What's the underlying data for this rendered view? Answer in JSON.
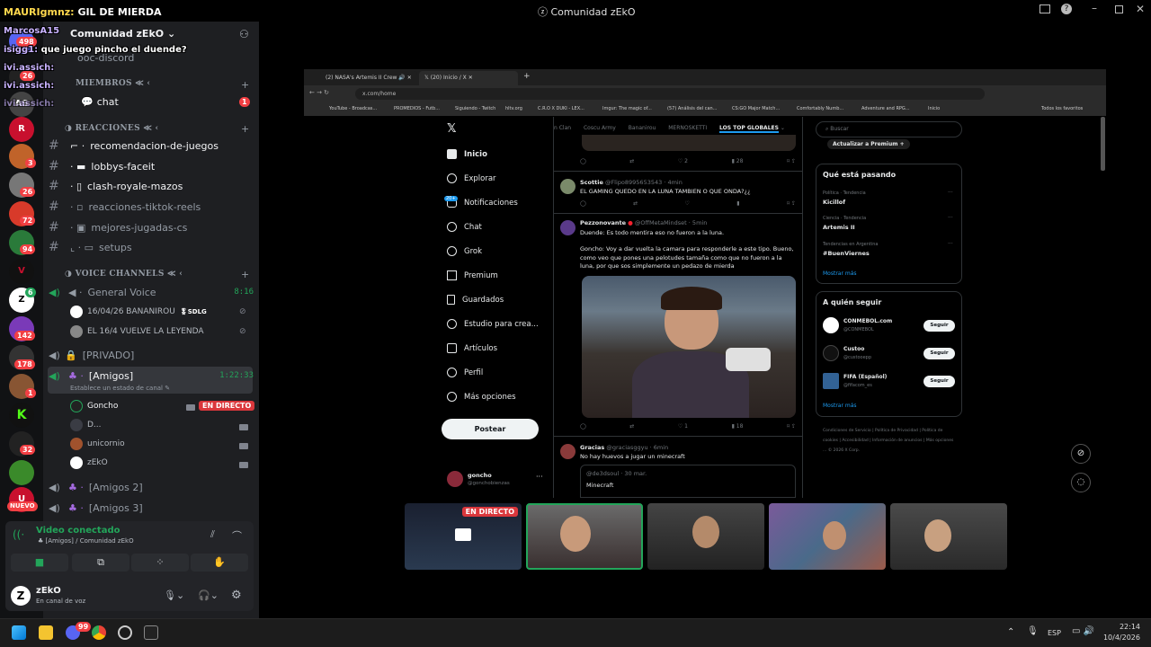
{
  "window": {
    "title": "Comunidad zEkO",
    "streaming_icon": "ⓩ"
  },
  "top_chat": {
    "user": "MAURIgmnz:",
    "msg": "GIL DE MIERDA"
  },
  "server": {
    "name": "Comunidad zEkO"
  },
  "overlay_chat": [
    {
      "user": "MarcosA15",
      "msg": ""
    },
    {
      "user": "isigg1:",
      "msg": "que juego pincho el duende?"
    },
    {
      "user": "ivi.assich:",
      "msg": ""
    },
    {
      "user": "ivi.assich:",
      "msg": ""
    },
    {
      "user": "ivi.assich:",
      "msg": ""
    }
  ],
  "guild_badges": [
    "498",
    "26",
    "3",
    "26",
    "72",
    "94",
    "6",
    "142",
    "178",
    "1",
    "32",
    "NUEVO"
  ],
  "channels": {
    "ooc": "ooc-discord",
    "cat_miembros": "MIEMBROS",
    "chat": "chat",
    "chat_badge": "1",
    "cat_reacciones": "REACCIONES",
    "list": [
      "recomendacion-de-juegos",
      "lobbys-faceit",
      "clash-royale-mazos",
      "reacciones-tiktok-reels",
      "mejores-jugadas-cs",
      "setups"
    ],
    "cat_voice": "VOICE CHANNELS",
    "general_voice": "General Voice",
    "general_time": "8:16",
    "gv_users": [
      {
        "name": "16/04/26 BANANIROU",
        "tag": "SDLG"
      },
      {
        "name": "EL 16/4 VUELVE LA LEYENDA",
        "tag": ""
      }
    ],
    "privado": "[PRIVADO]",
    "amigos": "[Amigos]",
    "amigos_time": "1:22:33",
    "amigos_status": "Establece un estado de canal",
    "amigos_users": [
      {
        "name": "Goncho",
        "live": "EN DIRECTO"
      },
      {
        "name": "D..."
      },
      {
        "name": "unicornio"
      },
      {
        "name": "zEkO"
      }
    ],
    "amigos2": "[Amigos 2]",
    "amigos3": "[Amigos 3]"
  },
  "voice_panel": {
    "status": "Video conectado",
    "sub": "[Amigos] / Comunidad zEkO"
  },
  "user_panel": {
    "name": "zEkO",
    "status": "En canal de voz"
  },
  "browser": {
    "tabs": [
      "(2) NASA's Artemis II Crew",
      "(20) Inicio / X"
    ],
    "url": "x.com/home",
    "bookmarks": [
      "YouTube - Broadcas...",
      "PROMEDIOS - Futb...",
      "Siguiendo - Twitch",
      "hltv.org",
      "C.R.O X DUKI - LEX...",
      "Imgur: The magic of...",
      "(57) Análisis del can...",
      "CS:GO Major Match...",
      "Comfortably Numb...",
      "Adventure and RPG...",
      "Inicio",
      "Todos los favoritos"
    ]
  },
  "x_nav": [
    "Inicio",
    "Explorar",
    "Notificaciones",
    "Chat",
    "Grok",
    "Premium",
    "Guardados",
    "Estudio para crea...",
    "Artículos",
    "Perfil",
    "Más opciones"
  ],
  "x_post_button": "Postear",
  "x_profile": {
    "name": "goncho",
    "handle": "@gonchobienzas"
  },
  "x_notif_badge": "20+",
  "feed_tabs": [
    "n Clan",
    "Coscu Army",
    "Bananirou",
    "MERNOSKETTI",
    "LOS TOP GLOBALES"
  ],
  "tweets": [
    {
      "name": "Scottie",
      "handle": "@Flipo8995653543 · 4min",
      "text": "EL GAMING QUEDO EN LA LUNA TAMBIEN O QUE ONDA?¿¿"
    },
    {
      "name": "Pezzonovante",
      "handle": "@OffMetaMindset · 5min",
      "text": "Duende: Es todo mentira eso no fueron a la luna.",
      "text2": "Goncho: Voy a dar vuelta la camara para responderle a este tipo. Bueno, como veo que pones una pelotudes tamaña como que no fueron a la luna, por que sos simplemente un pedazo de mierda"
    },
    {
      "name": "Gracias",
      "handle": "@graciasggyu · 6min",
      "text": "No hay huevos a jugar un minecraft",
      "quote": "@de3dsoul · 30 mar.",
      "quote_text": "Minecraft"
    }
  ],
  "tweet_stats": [
    {
      "likes": "2",
      "views": "28"
    },
    {
      "likes": "",
      "views": ""
    },
    {
      "likes": "1",
      "views": "18"
    }
  ],
  "right": {
    "search": "Buscar",
    "premium": "Actualizar a Premium +",
    "trends_title": "Qué está pasando",
    "trends": [
      {
        "cat": "Política · Tendencia",
        "name": "Kicillof"
      },
      {
        "cat": "Ciencia · Tendencia",
        "name": "Artemis II"
      },
      {
        "cat": "Tendencias en Argentina",
        "name": "#BuenViernes"
      }
    ],
    "show_more": "Mostrar más",
    "follow_title": "A quién seguir",
    "follow": [
      {
        "name": "CONMEBOL.com",
        "handle": "@CONMEBOL"
      },
      {
        "name": "Custoo",
        "handle": "@custooepp"
      },
      {
        "name": "FIFA (Español)",
        "handle": "@fifacom_es"
      }
    ],
    "follow_btn": "Seguir",
    "footer": "Condiciones de Servicio | Política de Privacidad | Política de cookies | Accesibilidad | Información de anuncios | Más opciones ... © 2026 X Corp."
  },
  "thumb_live": "EN DIRECTO",
  "taskbar": {
    "lang": "ESP",
    "time": "22:14",
    "date": "10/4/2026",
    "badge": "99"
  }
}
